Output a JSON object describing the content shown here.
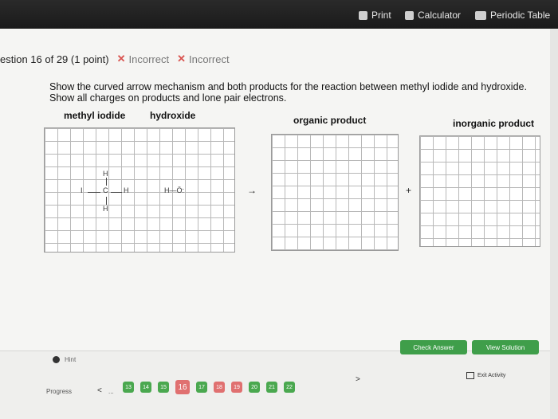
{
  "toolbar": {
    "print": "Print",
    "calculator": "Calculator",
    "periodic_table": "Periodic Table"
  },
  "question": {
    "header": "estion 16 of 29 (1 point)",
    "attempt1": "Incorrect",
    "attempt2": "Incorrect",
    "prompt": "Show the curved arrow mechanism and both products for the reaction between methyl iodide and hydroxide. Show all charges on products and lone pair electrons."
  },
  "labels": {
    "methyl_iodide": "methyl iodide",
    "hydroxide": "hydroxide",
    "organic_product": "organic product",
    "inorganic_product": "inorganic product"
  },
  "molecules": {
    "methyl_iodide_atoms": [
      "I",
      "C",
      "H",
      "H",
      "H"
    ],
    "hydroxide_text": "H—Ö:"
  },
  "symbols": {
    "arrow": "→",
    "plus": "+"
  },
  "buttons": {
    "check_answer": "Check Answer",
    "view_solution": "View Solution",
    "hint": "Hint",
    "exit_activity": "Exit Activity"
  },
  "progress": {
    "label": "Progress",
    "prev": "<",
    "ellipsis": "...",
    "next": ">",
    "current": "16",
    "items": [
      "13",
      "14",
      "15",
      "16",
      "17",
      "18",
      "19",
      "20",
      "21",
      "22"
    ]
  }
}
